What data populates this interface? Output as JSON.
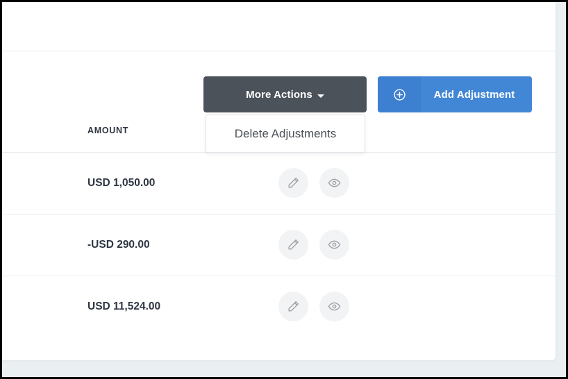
{
  "window": {
    "frame_color": "#000000",
    "page_background": "#eaeff2",
    "card_background": "#ffffff"
  },
  "toolbar": {
    "more_actions_label": "More Actions",
    "more_actions_caret_icon": "chevron-down-icon",
    "more_actions_bg": "#4c525a",
    "add_adjustment_label": "Add Adjustment",
    "add_adjustment_icon": "plus-circle-icon",
    "add_adjustment_bg": "#3d7fd0"
  },
  "dropdown": {
    "open": true,
    "items": [
      {
        "label": "Delete Adjustments"
      }
    ]
  },
  "table": {
    "columns": [
      "AMOUNT"
    ],
    "rows": [
      {
        "amount": "USD 1,050.00",
        "edit_icon": "pencil-icon",
        "view_icon": "eye-icon"
      },
      {
        "amount": "-USD 290.00",
        "edit_icon": "pencil-icon",
        "view_icon": "eye-icon"
      },
      {
        "amount": "USD 11,524.00",
        "edit_icon": "pencil-icon",
        "view_icon": "eye-icon"
      }
    ]
  }
}
